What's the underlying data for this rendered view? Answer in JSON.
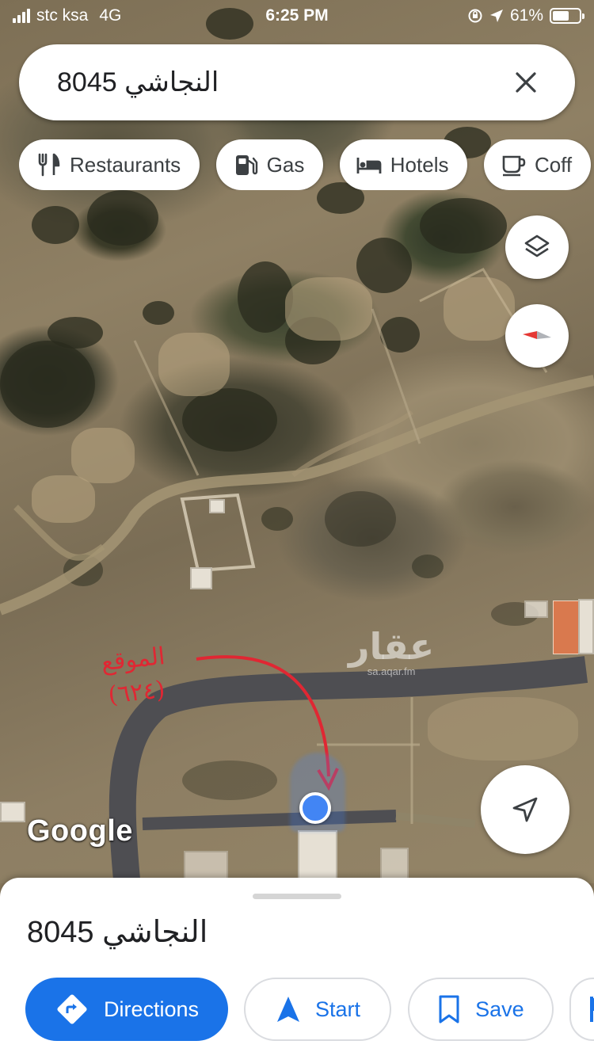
{
  "status_bar": {
    "carrier": "stc ksa",
    "network": "4G",
    "time": "6:25 PM",
    "battery": "61%",
    "battery_level": 0.61
  },
  "search": {
    "query": "8045 النجاشي",
    "close_icon": "close-icon"
  },
  "chips": [
    {
      "label": "Restaurants",
      "icon": "fork-knife-icon"
    },
    {
      "label": "Gas",
      "icon": "gas-pump-icon"
    },
    {
      "label": "Hotels",
      "icon": "bed-icon"
    },
    {
      "label": "Coff",
      "icon": "coffee-cup-icon"
    }
  ],
  "map": {
    "google_watermark": "Google",
    "site_watermark": {
      "text": "عقار",
      "url": "sa.aqar.fm"
    },
    "annotation": {
      "line1": "الموقع",
      "line2": "(٦٢٤)",
      "color": "#e02733"
    },
    "buttons": {
      "layers": "layers-icon",
      "compass": "compass-icon",
      "my_location": "navigation-arrow-icon"
    }
  },
  "sheet": {
    "title": "8045 النجاشي",
    "actions": {
      "directions": "Directions",
      "start": "Start",
      "save": "Save"
    }
  },
  "colors": {
    "accent": "#1a73e8",
    "location_dot": "#4285f4"
  }
}
